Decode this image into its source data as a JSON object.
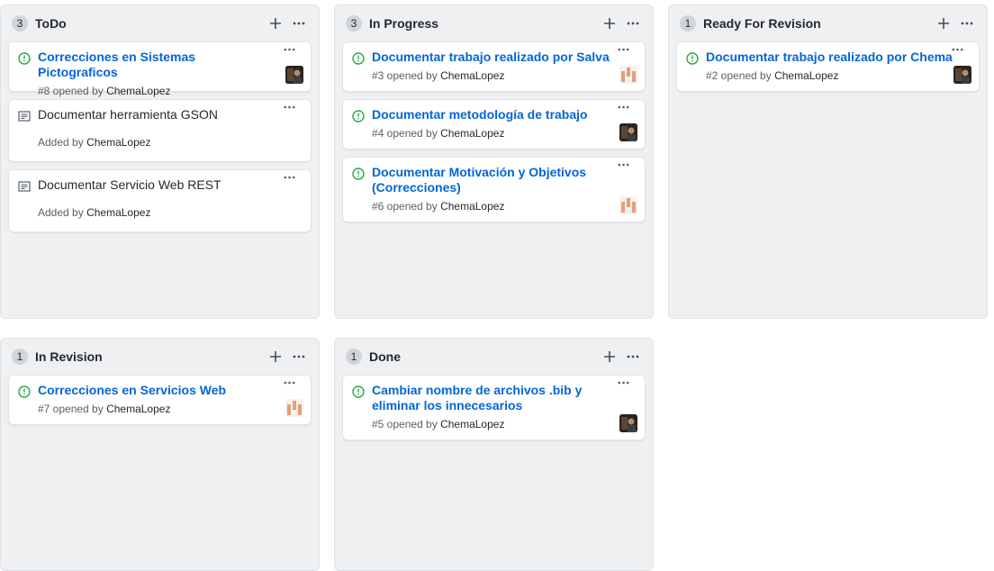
{
  "colors": {
    "issue_green": "#28a745",
    "link_blue": "#0366d6",
    "column_bg": "#eff0f2",
    "identicon": "#e0a07c"
  },
  "columns": [
    {
      "name": "ToDo",
      "count": "3",
      "cards": [
        {
          "type": "issue",
          "title": "Correcciones en Sistemas Pictograficos",
          "meta_prefix": "#8 opened by",
          "user": "ChemaLopez",
          "avatar": "photo"
        },
        {
          "type": "note",
          "title": "Documentar herramienta GSON",
          "meta_prefix": "Added by",
          "user": "ChemaLopez",
          "avatar": ""
        },
        {
          "type": "note",
          "title": "Documentar Servicio Web REST",
          "meta_prefix": "Added by",
          "user": "ChemaLopez",
          "avatar": ""
        }
      ]
    },
    {
      "name": "In Progress",
      "count": "3",
      "cards": [
        {
          "type": "issue",
          "title": "Documentar trabajo realizado por Salva",
          "meta_prefix": "#3 opened by",
          "user": "ChemaLopez",
          "avatar": "identicon"
        },
        {
          "type": "issue",
          "title": "Documentar metodología de trabajo",
          "meta_prefix": "#4 opened by",
          "user": "ChemaLopez",
          "avatar": "photo"
        },
        {
          "type": "issue",
          "title": "Documentar Motivación y Objetivos (Correcciones)",
          "meta_prefix": "#6 opened by",
          "user": "ChemaLopez",
          "avatar": "identicon"
        }
      ]
    },
    {
      "name": "Ready For Revision",
      "count": "1",
      "cards": [
        {
          "type": "issue",
          "title": "Documentar trabajo realizado por Chema",
          "meta_prefix": "#2 opened by",
          "user": "ChemaLopez",
          "avatar": "photo"
        }
      ]
    },
    {
      "name": "In Revision",
      "count": "1",
      "cards": [
        {
          "type": "issue",
          "title": "Correcciones en Servicios Web",
          "meta_prefix": "#7 opened by",
          "user": "ChemaLopez",
          "avatar": "identicon"
        }
      ]
    },
    {
      "name": "Done",
      "count": "1",
      "cards": [
        {
          "type": "issue",
          "title": "Cambiar nombre de archivos .bib y eliminar los innecesarios",
          "meta_prefix": "#5 opened by",
          "user": "ChemaLopez",
          "avatar": "photo"
        }
      ]
    }
  ]
}
